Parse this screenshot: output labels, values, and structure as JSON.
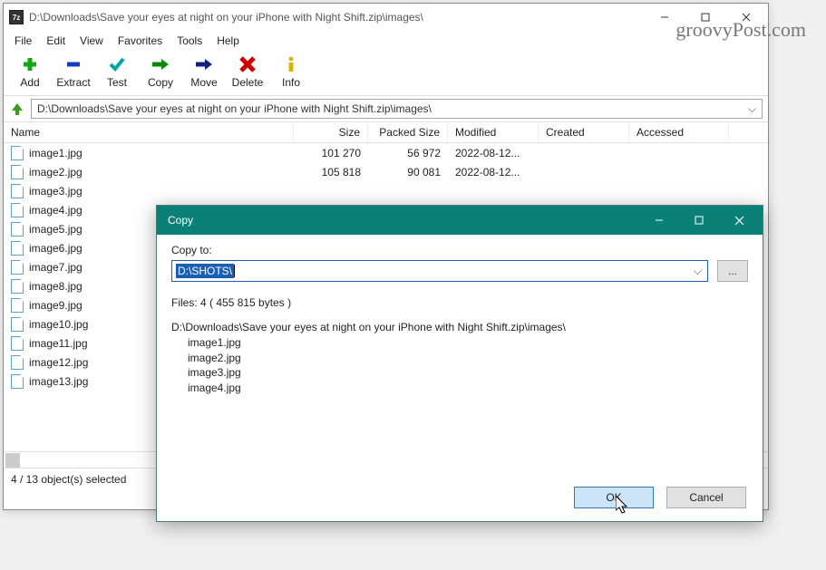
{
  "watermark": "groovyPost.com",
  "window": {
    "title": "D:\\Downloads\\Save your eyes at night on your iPhone with Night Shift.zip\\images\\",
    "app_badge": "7z"
  },
  "menu": {
    "file": "File",
    "edit": "Edit",
    "view": "View",
    "favorites": "Favorites",
    "tools": "Tools",
    "help": "Help"
  },
  "toolbar": {
    "add": "Add",
    "extract": "Extract",
    "test": "Test",
    "copy": "Copy",
    "move": "Move",
    "delete": "Delete",
    "info": "Info"
  },
  "path": "D:\\Downloads\\Save your eyes at night on your iPhone with Night Shift.zip\\images\\",
  "columns": {
    "name": "Name",
    "size": "Size",
    "packed": "Packed Size",
    "modified": "Modified",
    "created": "Created",
    "accessed": "Accessed"
  },
  "files": [
    {
      "name": "image1.jpg",
      "size": "101 270",
      "packed": "56 972",
      "modified": "2022-08-12..."
    },
    {
      "name": "image2.jpg",
      "size": "105 818",
      "packed": "90 081",
      "modified": "2022-08-12..."
    },
    {
      "name": "image3.jpg",
      "size": "",
      "packed": "",
      "modified": ""
    },
    {
      "name": "image4.jpg",
      "size": "",
      "packed": "",
      "modified": ""
    },
    {
      "name": "image5.jpg",
      "size": "",
      "packed": "",
      "modified": ""
    },
    {
      "name": "image6.jpg",
      "size": "",
      "packed": "",
      "modified": ""
    },
    {
      "name": "image7.jpg",
      "size": "",
      "packed": "",
      "modified": ""
    },
    {
      "name": "image8.jpg",
      "size": "",
      "packed": "",
      "modified": ""
    },
    {
      "name": "image9.jpg",
      "size": "",
      "packed": "",
      "modified": ""
    },
    {
      "name": "image10.jpg",
      "size": "",
      "packed": "",
      "modified": ""
    },
    {
      "name": "image11.jpg",
      "size": "",
      "packed": "",
      "modified": ""
    },
    {
      "name": "image12.jpg",
      "size": "",
      "packed": "",
      "modified": ""
    },
    {
      "name": "image13.jpg",
      "size": "",
      "packed": "",
      "modified": ""
    }
  ],
  "status": "4 / 13 object(s) selected",
  "dialog": {
    "title": "Copy",
    "copyto_label": "Copy to:",
    "dest": "D:\\SHOTS\\",
    "browse": "...",
    "summary": "Files: 4   ( 455 815 bytes )",
    "source": "D:\\Downloads\\Save your eyes at night on your iPhone with Night Shift.zip\\images\\",
    "items": [
      "image1.jpg",
      "image2.jpg",
      "image3.jpg",
      "image4.jpg"
    ],
    "ok": "OK",
    "cancel": "Cancel"
  }
}
